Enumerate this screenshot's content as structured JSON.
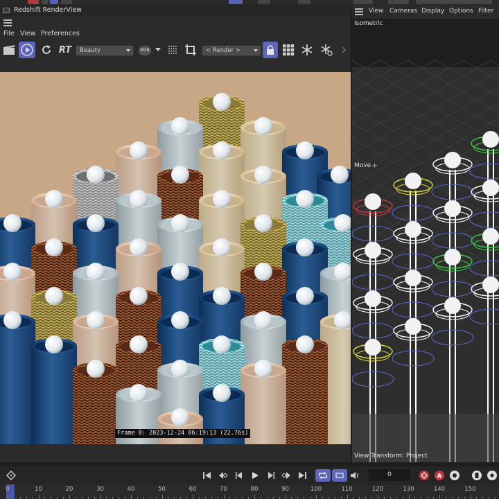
{
  "render_view": {
    "title": "Redshift RenderView",
    "menu": [
      "File",
      "View",
      "Preferences"
    ],
    "aov_select": "Beauty",
    "rgb_label": "RGB",
    "rt_label": "RT",
    "render_select": "< Render >",
    "frame_info": "Frame  0:  2023-12-24  06:19:13  (22.76s)"
  },
  "viewport": {
    "menu": [
      "View",
      "Cameras",
      "Display",
      "Options",
      "Filter"
    ],
    "camera_label": "Isometric",
    "tool_label": "Move",
    "transform_label": "View Transform: Project"
  },
  "timeline": {
    "current_frame": "0",
    "ruler_labels": [
      "0",
      "10",
      "20",
      "30",
      "40",
      "50",
      "60",
      "70",
      "80",
      "90",
      "100",
      "110",
      "120",
      "130",
      "140",
      "150"
    ]
  },
  "colors": {
    "accent": "#5d66b8",
    "render_bg": "#c8a787",
    "record": "#c0393b"
  }
}
